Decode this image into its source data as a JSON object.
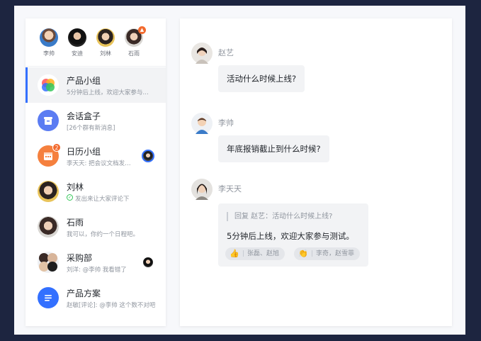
{
  "contacts": [
    {
      "name": "李帅"
    },
    {
      "name": "安迪"
    },
    {
      "name": "刘林"
    },
    {
      "name": "石雨"
    }
  ],
  "conversations": [
    {
      "title": "产品小组",
      "preview": "5分钟后上线，欢迎大家参与…",
      "icon": "product-group-icon"
    },
    {
      "title": "会话盒子",
      "preview": "[26个群有新消息]",
      "icon": "archive-box-icon"
    },
    {
      "title": "日历小组",
      "preview": "李天天: 把会议文档发…",
      "icon": "calendar-icon",
      "badge": "2"
    },
    {
      "title": "刘林",
      "preview": "发出来让大家评论下",
      "icon": "avatar"
    },
    {
      "title": "石雨",
      "preview": "我可以，你约一个日程吧。",
      "icon": "avatar"
    },
    {
      "title": "采购部",
      "preview": "刘洋: @李帅 我看错了",
      "icon": "group-avatar"
    },
    {
      "title": "产品方案",
      "preview": "赵敏[评论]: @李帅 这个数不对吧",
      "icon": "doc-icon"
    }
  ],
  "messages": [
    {
      "sender": "赵艺",
      "text": "活动什么时候上线?"
    },
    {
      "sender": "李帅",
      "text": "年底报销截止到什么时候?"
    },
    {
      "sender": "李天天",
      "quote": "回复 赵艺：活动什么时候上线?",
      "text": "5分钟后上线，欢迎大家参与测试。",
      "reactions": [
        {
          "emoji": "thumbs-up",
          "glyph": "👍",
          "users": "张磊、赵旭"
        },
        {
          "emoji": "clap",
          "glyph": "👏",
          "users": "李奇，赵雪菲"
        }
      ]
    }
  ],
  "colors": {
    "accent": "#3370ff",
    "badge": "#f26a2e",
    "background": "#1d2540"
  }
}
